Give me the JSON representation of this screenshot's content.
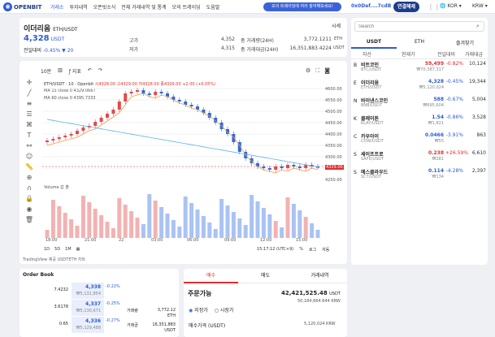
{
  "nav": {
    "logo": "OPENBIT",
    "menu": [
      "거래소",
      "투자내역",
      "오픈빗소식",
      "전체 거래내역 및 통계",
      "모의 트레이딩",
      "도움말"
    ],
    "notice": "모의 트레이딩에 여러 참여해보세요!",
    "address": "0x0Def....7cdB",
    "connect": "연결해제",
    "lang": "KOR",
    "currency": "KRW"
  },
  "ticker": {
    "name": "이더리움",
    "pair": "ETH/USDT",
    "price": "4,328",
    "unit": "USDT",
    "change_label": "전일대비",
    "change_pct": "-0.45%",
    "change_abs": "▼ 20",
    "high_label": "고가",
    "high": "4,352",
    "low_label": "저가",
    "low": "4,315",
    "vol_label": "총 거래량(24H)",
    "vol": "3,772.1211",
    "vol_unit": "ETH",
    "amt_label": "총 거래대금(24H)",
    "amt": "16,351,883.4224",
    "amt_unit": "USDT",
    "sise": "시세"
  },
  "chart": {
    "interval": "10분",
    "indicator": "지표",
    "ohlc_label": "ETH/USDT · 10 · Openbit",
    "ohlc": "시4328.00 고4329.00 저4328.00 종4329.00 +2.00 (+0.05%)",
    "ma15": "MA 15 close 0  4329.0667",
    "ma60": "MA 60 close 0  4395.7333",
    "volume": "Volume 값 출",
    "times": [
      "18:00",
      "21:00",
      "22",
      "03:00",
      "06:00",
      "09:00",
      "12:00",
      "15:00"
    ],
    "prices": [
      "4600.00",
      "4550.00",
      "4500.00",
      "4450.00",
      "4400.00",
      "4350.00",
      "4300.00",
      "4250.00"
    ],
    "cur_price": "4329.00",
    "ranges": [
      "1D",
      "5D",
      "1M"
    ],
    "clock": "15:17:12 (UTC+9)",
    "pct": "%",
    "logs": "로그",
    "auto": "자동",
    "footer": "TradingView 제공 USDTETH 차트"
  },
  "search": {
    "placeholder": "Search"
  },
  "side_tabs": [
    "USDT",
    "ETH",
    "즐겨찾기"
  ],
  "cols": [
    "자산",
    "현재가",
    "전일대비",
    "거래대금"
  ],
  "coins": [
    {
      "icon": "B",
      "name": "비트코인",
      "sym": "BTC/USDT",
      "price": "59,499",
      "krw": "₩70,387,317",
      "pct": "-0.82%",
      "vol": "10,124",
      "color": "#e02d2d"
    },
    {
      "icon": "E",
      "name": "이더리움",
      "sym": "ETH/USDT",
      "price": "4,328",
      "krw": "₩5,120,024",
      "pct": "-0.45%",
      "vol": "19,344",
      "color": "#2d5bd6"
    },
    {
      "icon": "N",
      "name": "바이낸스코인",
      "sym": "BNB/USDT",
      "price": "588",
      "krw": "₩695,604",
      "pct": "-0.67%",
      "vol": "5,004",
      "color": "#2d5bd6"
    },
    {
      "icon": "K",
      "name": "클레이튼",
      "sym": "KLAY/USDT",
      "price": "1.54",
      "krw": "₩1,821",
      "pct": "-0.86%",
      "vol": "3,528",
      "color": "#2d5bd6"
    },
    {
      "icon": "C",
      "name": "카우아이",
      "sym": "COW/USDT",
      "price": "0.0466",
      "krw": "₩55",
      "pct": "-3.91%",
      "vol": "863",
      "color": "#2d5bd6"
    },
    {
      "icon": "S",
      "name": "세이프프로",
      "sym": "SAFE/USDT",
      "price": "0.238",
      "krw": "₩281",
      "pct": "+26.59%",
      "vol": "6,610",
      "color": "#e02d2d"
    },
    {
      "icon": "S",
      "name": "에스클라우드",
      "sym": "SCT/USDT",
      "price": "0.114",
      "krw": "₩134",
      "pct": "-4.28%",
      "vol": "2,397",
      "color": "#2d5bd6"
    }
  ],
  "orderbook": {
    "title": "Order Book",
    "rows": [
      {
        "qty": "7.4232",
        "price": "4,338",
        "krw": "₩5,131,854",
        "pct": "-0.22%"
      },
      {
        "qty": "3.6178",
        "price": "4,337",
        "krw": "₩5,130,671",
        "pct": "-0.25%"
      },
      {
        "qty": "0.65",
        "price": "4,336",
        "krw": "₩5,129,488",
        "pct": "-0.27%"
      }
    ],
    "vol_label": "거래량",
    "vol": "3,772.12",
    "vol_unit": "ETH",
    "amt_label": "거래금",
    "amt": "16,351,883",
    "amt_unit": "USDT"
  },
  "trade": {
    "tabs": [
      "매수",
      "매도",
      "거래내역"
    ],
    "avail": "주문가능",
    "avail_val": "42,421,525.48",
    "avail_unit": "USDT",
    "avail_krw": "50,184,664.644 KRW",
    "limit": "지정가",
    "market": "시장가",
    "buy_price": "매수가격 (USDT)",
    "buy_krw": "5,120,024 KRW"
  }
}
